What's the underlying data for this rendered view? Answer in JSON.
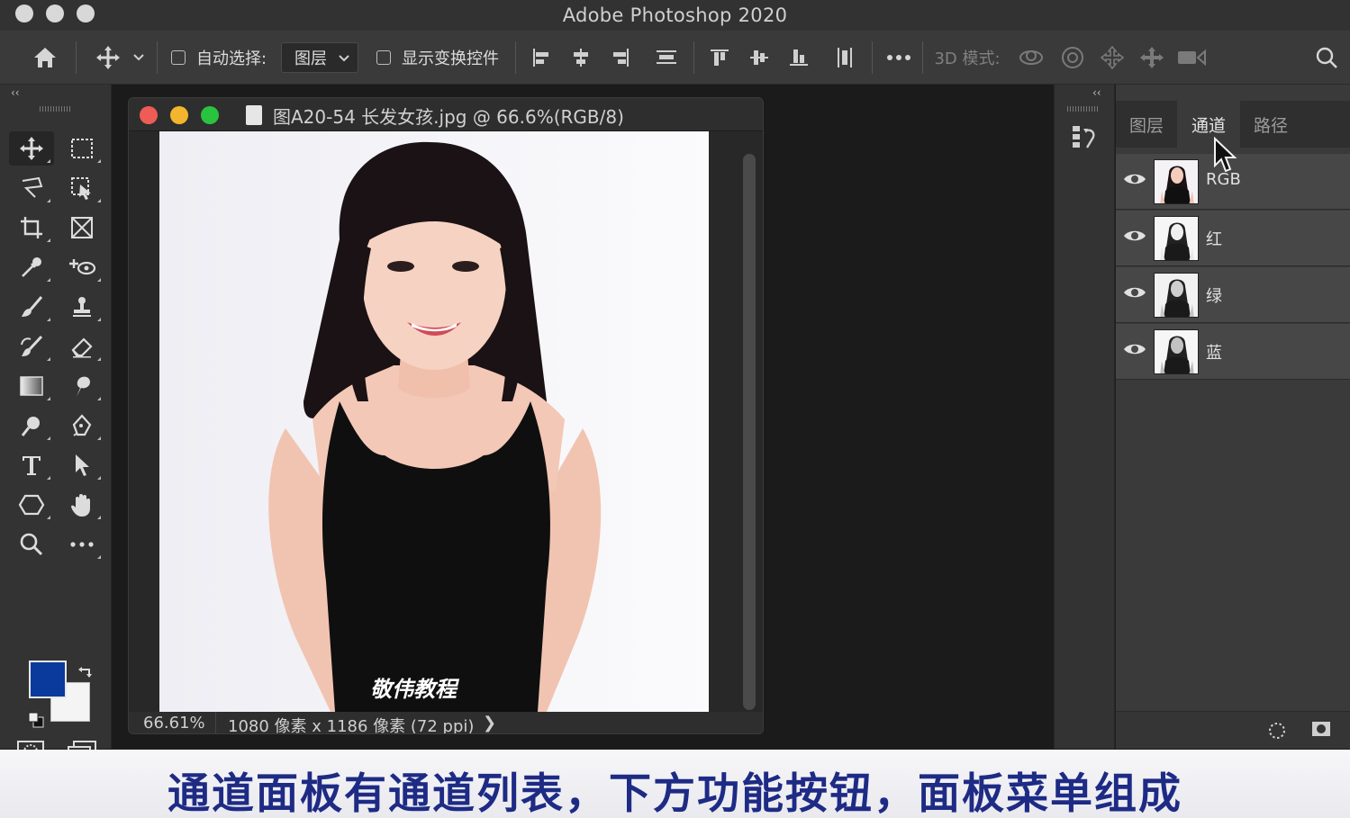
{
  "app": {
    "title": "Adobe Photoshop 2020"
  },
  "options_bar": {
    "auto_select_label": "自动选择:",
    "auto_select_checked": false,
    "auto_select_target": "图层",
    "show_transform_label": "显示变换控件",
    "show_transform_checked": false,
    "mode_3d_label": "3D 模式:"
  },
  "toolbar": {
    "collapse_glyph": "‹‹",
    "tools": [
      "move-tool",
      "rectangular-marquee-tool",
      "lasso-tool",
      "object-selection-tool",
      "crop-tool",
      "frame-tool",
      "eyedropper-tool",
      "spot-healing-tool",
      "brush-tool",
      "clone-stamp-tool",
      "history-brush-tool",
      "eraser-tool",
      "gradient-tool",
      "blur-tool",
      "dodge-tool",
      "pen-tool",
      "type-tool",
      "path-selection-tool",
      "polygon-tool",
      "hand-tool",
      "zoom-tool",
      "more-tools",
      "quick-mask",
      "screen-mode"
    ],
    "foreground_color": "#0a3a9c",
    "background_color": "#f4f4f4"
  },
  "document": {
    "tab_title": "图A20-54 长发女孩.jpg @ 66.6%(RGB/8)",
    "watermark": "敬伟教程",
    "zoom": "66.61%",
    "info": "1080 像素 x 1186 像素 (72 ppi)",
    "info_arrow": "❯"
  },
  "dock": {
    "collapse_glyph": "‹‹"
  },
  "channels_panel": {
    "tabs": [
      {
        "label": "图层",
        "active": false
      },
      {
        "label": "通道",
        "active": true
      },
      {
        "label": "路径",
        "active": false
      }
    ],
    "channels": [
      {
        "name": "RGB",
        "visible": true,
        "selected": true
      },
      {
        "name": "红",
        "visible": true,
        "selected": true
      },
      {
        "name": "绿",
        "visible": true,
        "selected": true
      },
      {
        "name": "蓝",
        "visible": true,
        "selected": true
      }
    ]
  },
  "caption": {
    "text": "通道面板有通道列表，下方功能按钮，面板菜单组成"
  }
}
